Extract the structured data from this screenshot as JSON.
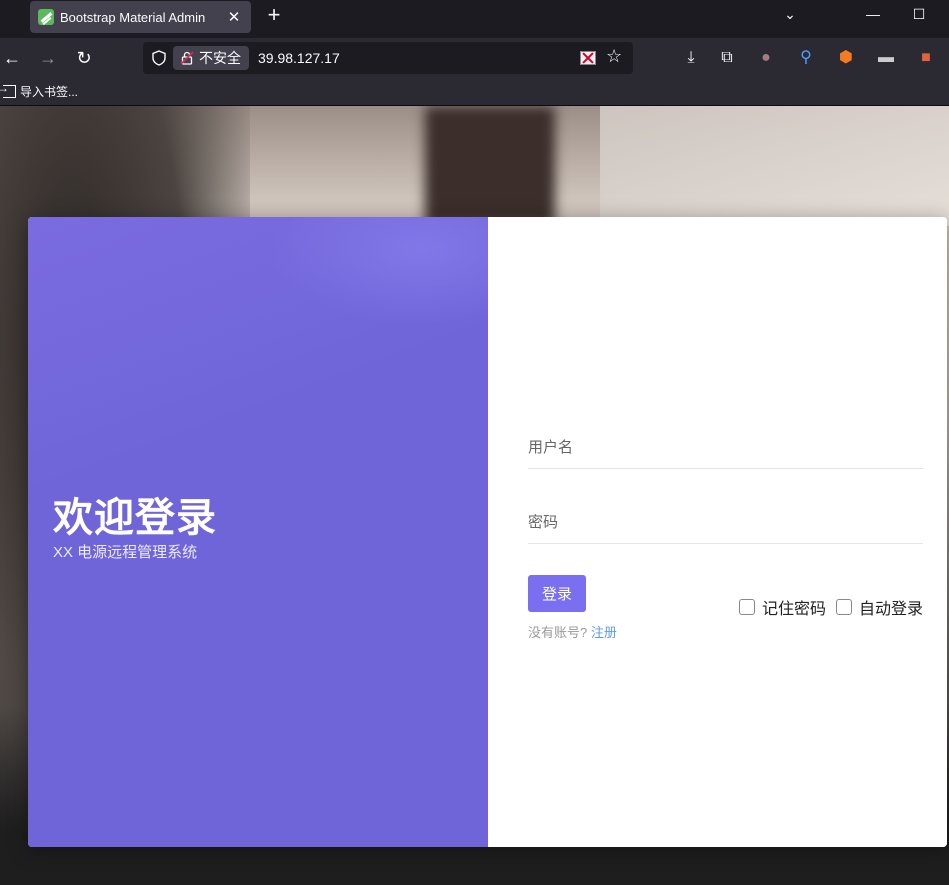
{
  "browser": {
    "tab_title": "Bootstrap Material Admin",
    "tab_close": "✕",
    "new_tab": "+",
    "security_label": "不安全",
    "url": "39.98.127.17",
    "bookmark_label": "导入书签...",
    "window_controls": {
      "dropdown": "⌄",
      "minimize": "—",
      "maximize": "☐"
    },
    "icons": [
      "back-icon",
      "forward-icon",
      "reload-icon",
      "shield-icon",
      "lock-icon",
      "blocked-image-icon",
      "star-icon",
      "download-icon",
      "extensions-icon",
      "extension-paws-icon",
      "extension-pin-icon",
      "extension-ublock-icon",
      "extension-hat-icon",
      "extension-red-icon"
    ]
  },
  "login": {
    "welcome_title": "欢迎登录",
    "subtitle": "XX 电源远程管理系统",
    "username_placeholder": "用户名",
    "password_placeholder": "密码",
    "login_button": "登录",
    "no_account": "没有账号?",
    "register_link": "注册",
    "remember_password": "记住密码",
    "auto_login": "自动登录"
  },
  "colors": {
    "accent_purple": "#6f65d9",
    "button_purple": "#7a6ff0",
    "link_blue": "#5d9cec"
  }
}
